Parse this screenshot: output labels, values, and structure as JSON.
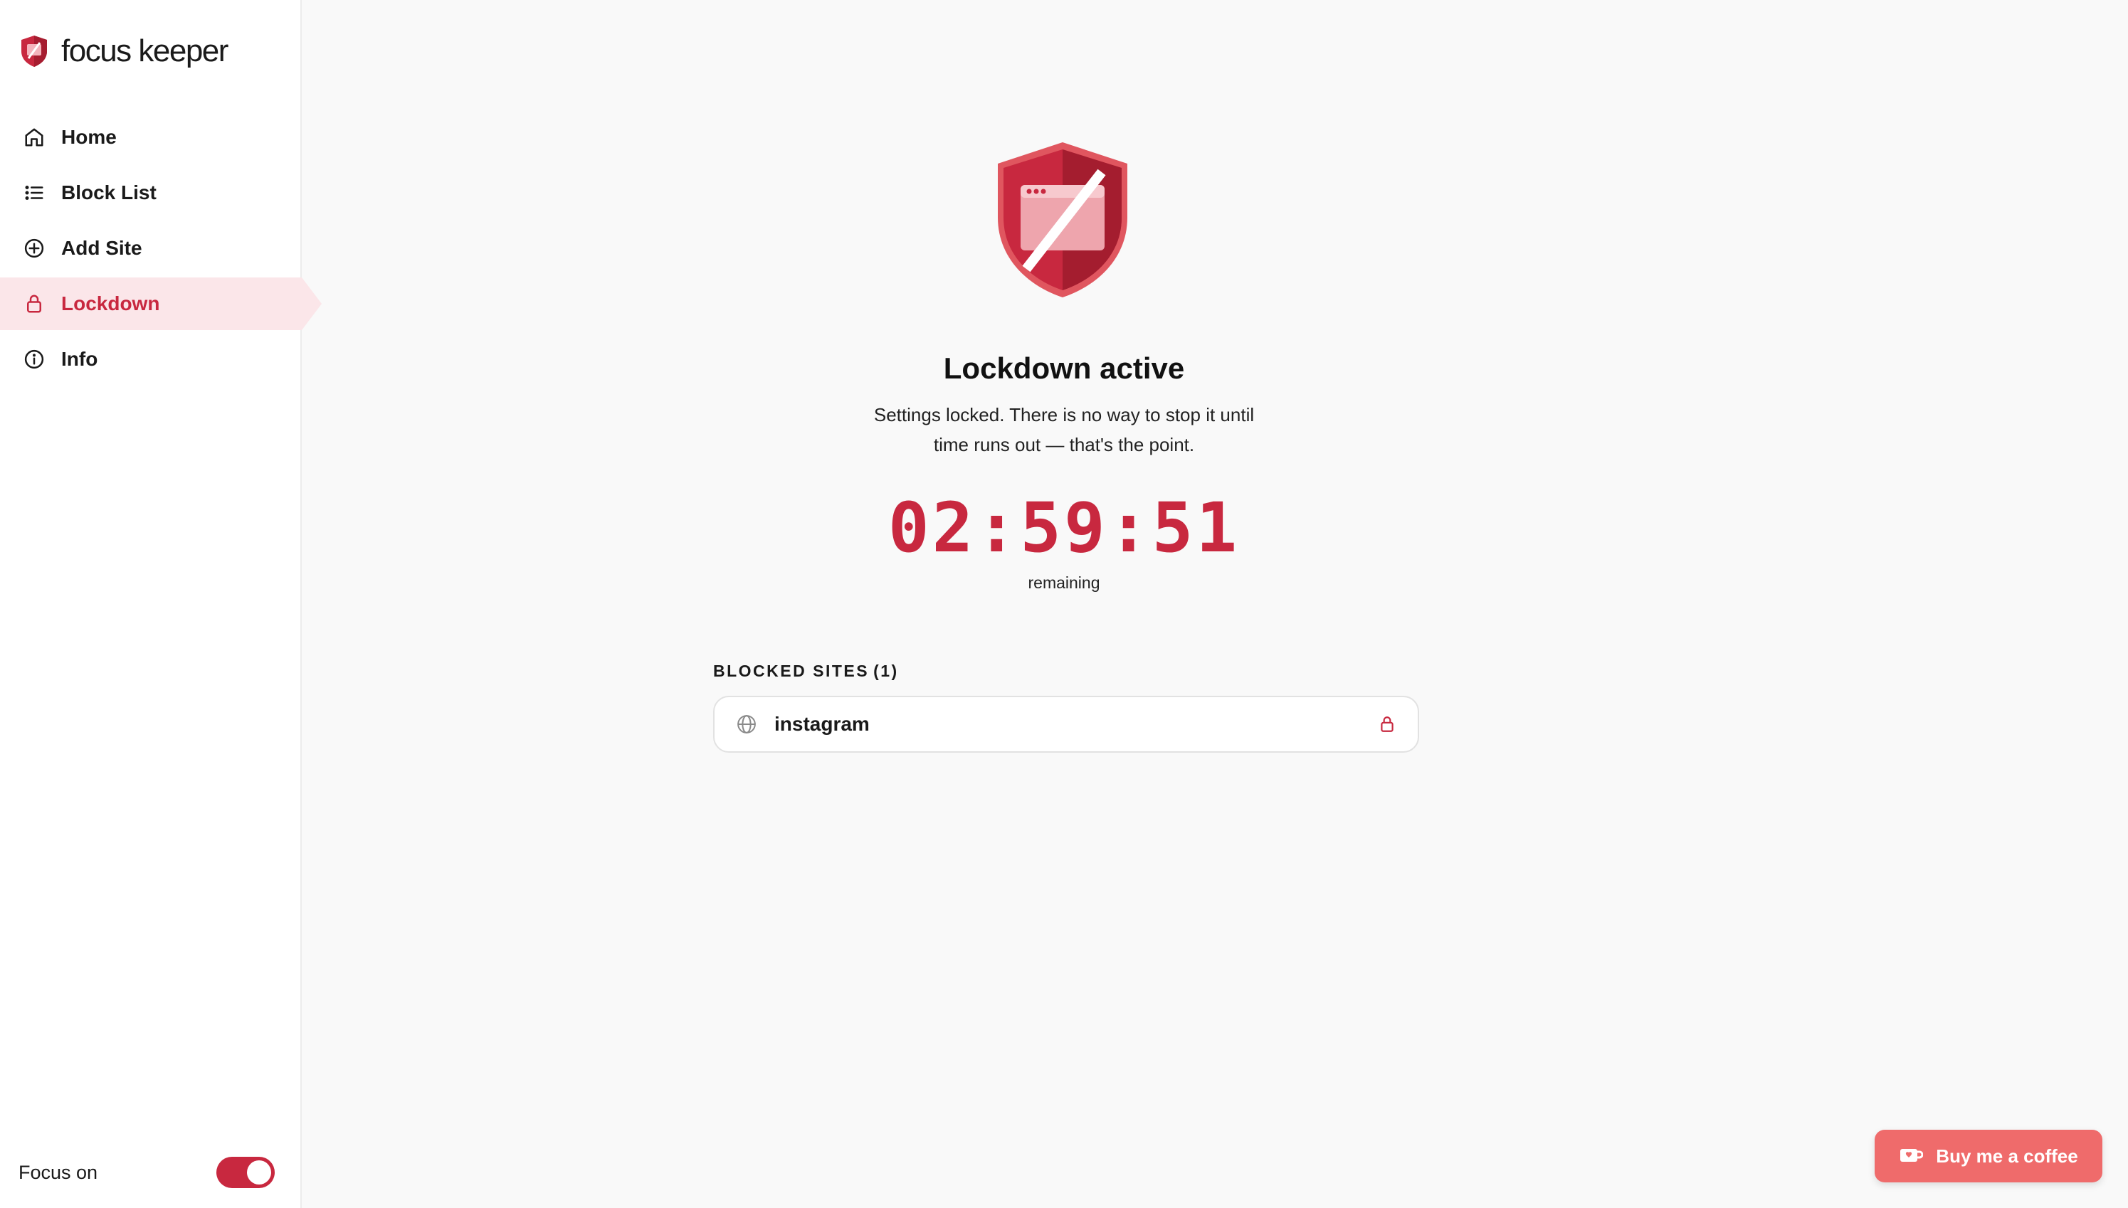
{
  "app": {
    "name": "focus keeper"
  },
  "sidebar": {
    "items": [
      {
        "label": "Home",
        "icon": "home-icon",
        "active": false
      },
      {
        "label": "Block List",
        "icon": "list-icon",
        "active": false
      },
      {
        "label": "Add Site",
        "icon": "plus-circle-icon",
        "active": false
      },
      {
        "label": "Lockdown",
        "icon": "lock-icon",
        "active": true
      },
      {
        "label": "Info",
        "icon": "info-icon",
        "active": false
      }
    ],
    "focus_label": "Focus on",
    "focus_enabled": true
  },
  "lockdown": {
    "title": "Lockdown active",
    "subtitle_line1": "Settings locked. There is no way to stop it until",
    "subtitle_line2": "time runs out — that's the point.",
    "timer": "02:59:51",
    "timer_caption": "remaining",
    "blocked_heading": "BLOCKED SITES",
    "blocked_count": "(1)",
    "sites": [
      {
        "name": "instagram",
        "icon": "globe-icon",
        "locked": true
      }
    ]
  },
  "coffee_button": {
    "label": "Buy me a coffee",
    "icon": "coffee-cup-icon"
  },
  "colors": {
    "accent": "#c8283f",
    "active_bg": "#fbe6e9",
    "coffee": "#ef6b6b",
    "background": "#f9f9f9"
  }
}
